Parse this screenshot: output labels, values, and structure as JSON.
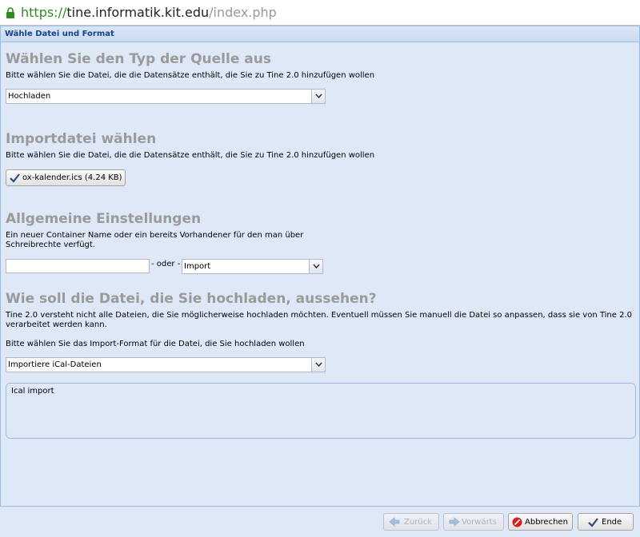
{
  "browser": {
    "url_scheme": "https://",
    "url_host": "tine.informatik.kit.edu",
    "url_path": "/index.php"
  },
  "dialog": {
    "title": "Wähle Datei und Format"
  },
  "source_section": {
    "title": "Wählen Sie den Typ der Quelle aus",
    "description": "Bitte wählen Sie die Datei, die die Datensätze enthält, die Sie zu Tine 2.0 hinzufügen wollen",
    "selected": "Hochladen"
  },
  "file_section": {
    "title": "Importdatei wählen",
    "description": "Bitte wählen Sie die Datei, die die Datensätze enthält, die Sie zu Tine 2.0 hinzufügen wollen",
    "file_button": "ox-kalender.ics (4.24 KB)"
  },
  "general_section": {
    "title": "Allgemeine Einstellungen",
    "description_line1": "Ein neuer Container Name oder ein bereits Vorhandener für den man über",
    "description_line2": "Schreibrechte verfügt.",
    "container_name_value": "",
    "separator": "- oder -",
    "container_selected": "Import"
  },
  "format_section": {
    "title": "Wie soll die Datei, die Sie hochladen, aussehen?",
    "description_line1": "Tine 2.0 versteht nicht alle Dateien, die Sie möglicherweise hochladen möchten. Eventuell müssen Sie manuell die Datei so anpassen, dass sie von Tine 2.0",
    "description_line2": "verarbeitet werden kann.",
    "format_prompt": "Bitte wählen Sie das Import-Format für die Datei, die Sie hochladen wollen",
    "format_selected": "Importiere iCal-Dateien",
    "format_description": "Ical import"
  },
  "footer": {
    "back_label": "Zurück",
    "next_label": "Vorwärts",
    "cancel_label": "Abbrechen",
    "finish_label": "Ende"
  },
  "icons": {
    "lock": "lock-icon",
    "check": "check-icon",
    "back": "arrow-left-icon",
    "next": "arrow-right-icon",
    "cancel": "cancel-icon",
    "finish": "check-icon"
  },
  "colors": {
    "panel_bg": "#dfe8f6",
    "header_text": "#15428b",
    "section_title": "#9a9a9a",
    "url_scheme": "#2e8b22"
  }
}
